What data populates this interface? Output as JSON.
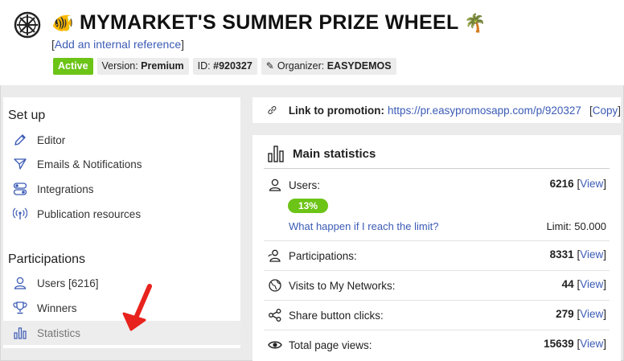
{
  "header": {
    "fish_emoji": "🐠",
    "title": "MYMARKET'S SUMMER PRIZE WHEEL",
    "palm_emoji": "🌴",
    "internal_ref_open": "[",
    "internal_ref_link": "Add an internal reference",
    "internal_ref_close": "]",
    "badges": {
      "status": "Active",
      "version_label": "Version: ",
      "version_value": "Premium",
      "id_label": "ID: ",
      "id_value": "#920327",
      "organizer_label": "Organizer: ",
      "organizer_value": "EASYDEMOS"
    }
  },
  "sidebar": {
    "setup_heading": "Set up",
    "setup_items": [
      {
        "label": "Editor",
        "icon": "pencil-icon"
      },
      {
        "label": "Emails & Notifications",
        "icon": "paper-plane-icon"
      },
      {
        "label": "Integrations",
        "icon": "toggles-icon"
      },
      {
        "label": "Publication resources",
        "icon": "broadcast-icon"
      }
    ],
    "participations_heading": "Participations",
    "participation_items": [
      {
        "label": "Users [6216]",
        "icon": "user-icon"
      },
      {
        "label": "Winners",
        "icon": "trophy-icon"
      },
      {
        "label": "Statistics",
        "icon": "bar-chart-icon",
        "selected": true
      }
    ]
  },
  "link": {
    "label": "Link to promotion:",
    "url": "https://pr.easypromosapp.com/p/920327",
    "copy_open": "[",
    "copy_label": "Copy",
    "copy_close": "]"
  },
  "stats": {
    "title": "Main statistics",
    "users_label": "Users:",
    "users_value": "6216",
    "users_progress": "13%",
    "users_progress_fraction": 0.13,
    "limit_question": "What happen if I reach the limit?",
    "limit_text": "Limit: 50.000",
    "view_open": "[",
    "view_label": "View",
    "view_close": "]",
    "rows": [
      {
        "label": "Participations:",
        "value": "8331",
        "icon": "participations-icon"
      },
      {
        "label": "Visits to My Networks:",
        "value": "44",
        "icon": "globe-icon"
      },
      {
        "label": "Share button clicks:",
        "value": "279",
        "icon": "share-icon"
      },
      {
        "label": "Total page views:",
        "value": "15639",
        "icon": "eye-icon"
      }
    ]
  },
  "colors": {
    "accent_green": "#6cc417",
    "link_blue": "#3b5bb5",
    "arrow_red": "#e8231d"
  }
}
